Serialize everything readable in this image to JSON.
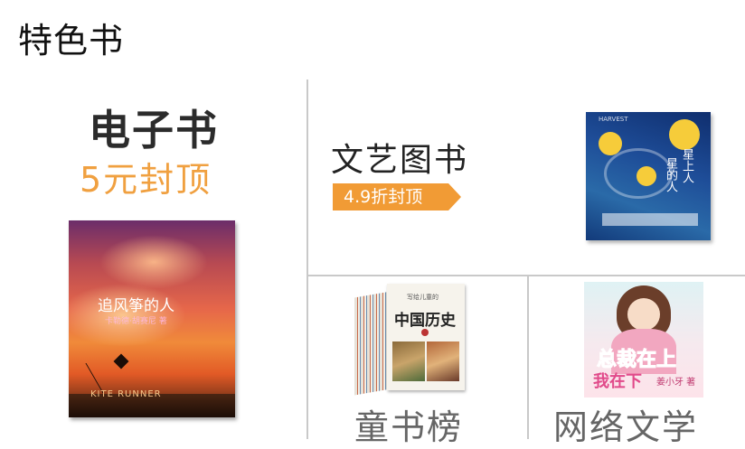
{
  "section": {
    "title": "特色书"
  },
  "ebook": {
    "heading": "电子书",
    "price_tag": "5元封顶",
    "cover": {
      "title": "追风筝的人",
      "subtitle": "卡勒德·胡赛尼 著",
      "english": "KITE RUNNER"
    }
  },
  "art_books": {
    "heading": "文艺图书",
    "badge": "4.9折封顶",
    "badge_color": "#f19b35",
    "cover": {
      "title_line1": "星上人",
      "title_line2": "星的人",
      "brand": "HARVEST"
    }
  },
  "children": {
    "label": "童书榜",
    "cover": {
      "series": "写给儿童的",
      "title": "中国历史"
    }
  },
  "web_literature": {
    "label": "网络文学",
    "cover": {
      "title_a": "总裁在上",
      "title_b": "我在下",
      "author": "姜小牙 著"
    }
  },
  "colors": {
    "accent": "#f0a040",
    "divider": "#c9c9c9"
  }
}
